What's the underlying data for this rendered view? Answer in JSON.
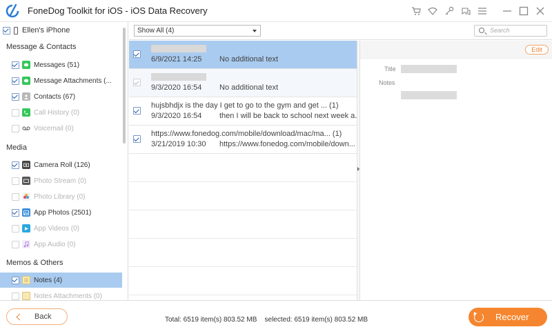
{
  "app": {
    "title": "FoneDog Toolkit for iOS - iOS Data Recovery"
  },
  "titlebar_icons": [
    "cart-icon",
    "wifi-icon",
    "key-icon",
    "chat-icon",
    "menu-icon",
    "minimize-icon",
    "maximize-icon",
    "close-icon"
  ],
  "device": {
    "label": "Ellen's iPhone",
    "checked": true
  },
  "sidebar": {
    "sections": [
      {
        "title": "Message & Contacts",
        "items": [
          {
            "label": "Messages (51)",
            "icon": "messages-icon",
            "icon_color": "#34c759",
            "checked": true,
            "enabled": true
          },
          {
            "label": "Message Attachments (...",
            "icon": "message-attachments-icon",
            "icon_color": "#34c759",
            "checked": true,
            "enabled": true
          },
          {
            "label": "Contacts (67)",
            "icon": "contacts-icon",
            "icon_color": "#a8a8a8",
            "checked": true,
            "enabled": true
          },
          {
            "label": "Call History (0)",
            "icon": "call-history-icon",
            "icon_color": "#34c759",
            "checked": false,
            "enabled": false
          },
          {
            "label": "Voicemail (0)",
            "icon": "voicemail-icon",
            "icon_color": "#555555",
            "checked": false,
            "enabled": false
          }
        ]
      },
      {
        "title": "Media",
        "items": [
          {
            "label": "Camera Roll (126)",
            "icon": "camera-roll-icon",
            "icon_color": "#444444",
            "checked": true,
            "enabled": true
          },
          {
            "label": "Photo Stream (0)",
            "icon": "photo-stream-icon",
            "icon_color": "#555555",
            "checked": false,
            "enabled": false
          },
          {
            "label": "Photo Library (0)",
            "icon": "photo-library-icon",
            "icon_color": "#f0a030",
            "checked": false,
            "enabled": false
          },
          {
            "label": "App Photos (2501)",
            "icon": "app-photos-icon",
            "icon_color": "#3b8ed8",
            "checked": true,
            "enabled": true
          },
          {
            "label": "App Videos (0)",
            "icon": "app-videos-icon",
            "icon_color": "#2aa8e0",
            "checked": false,
            "enabled": false
          },
          {
            "label": "App Audio (0)",
            "icon": "app-audio-icon",
            "icon_color": "#b48ad8",
            "checked": false,
            "enabled": false
          }
        ]
      },
      {
        "title": "Memos & Others",
        "items": [
          {
            "label": "Notes (4)",
            "icon": "notes-icon",
            "icon_color": "#e8c55a",
            "checked": true,
            "enabled": true,
            "active": true
          },
          {
            "label": "Notes Attachments (0)",
            "icon": "notes-attachments-icon",
            "icon_color": "#e8c55a",
            "checked": false,
            "enabled": false
          }
        ]
      }
    ]
  },
  "toolbar": {
    "filter_value": "Show All (4)",
    "search_placeholder": "Search"
  },
  "list": {
    "rows": [
      {
        "line1": "",
        "date": "6/9/2021 14:25",
        "text": "No additional text",
        "checked": true,
        "selected": true
      },
      {
        "line1": "",
        "date": "9/3/2020 16:54",
        "text": "No additional text",
        "checked": true,
        "disabled_check": true
      },
      {
        "line1": "hujsbhdjx is the day I get to go to the gym and get ... (1)",
        "date": "9/3/2020 16:54",
        "text": "then I will be back to school next week a...",
        "checked": true
      },
      {
        "line1": "https://www.fonedog.com/mobile/download/mac/ma... (1)",
        "date": "3/21/2019 10:30",
        "text": "https://www.fonedog.com/mobile/down...",
        "checked": true
      }
    ]
  },
  "detail": {
    "edit_label": "Edit",
    "title_label": "Title",
    "notes_label": "Notes"
  },
  "footer": {
    "back_label": "Back",
    "status": "Total: 6519 item(s) 803.52 MB    selected: 6519 item(s) 803.52 MB",
    "recover_label": "Recover"
  },
  "colors": {
    "accent": "#f5862f",
    "selection": "#a9cbef"
  }
}
